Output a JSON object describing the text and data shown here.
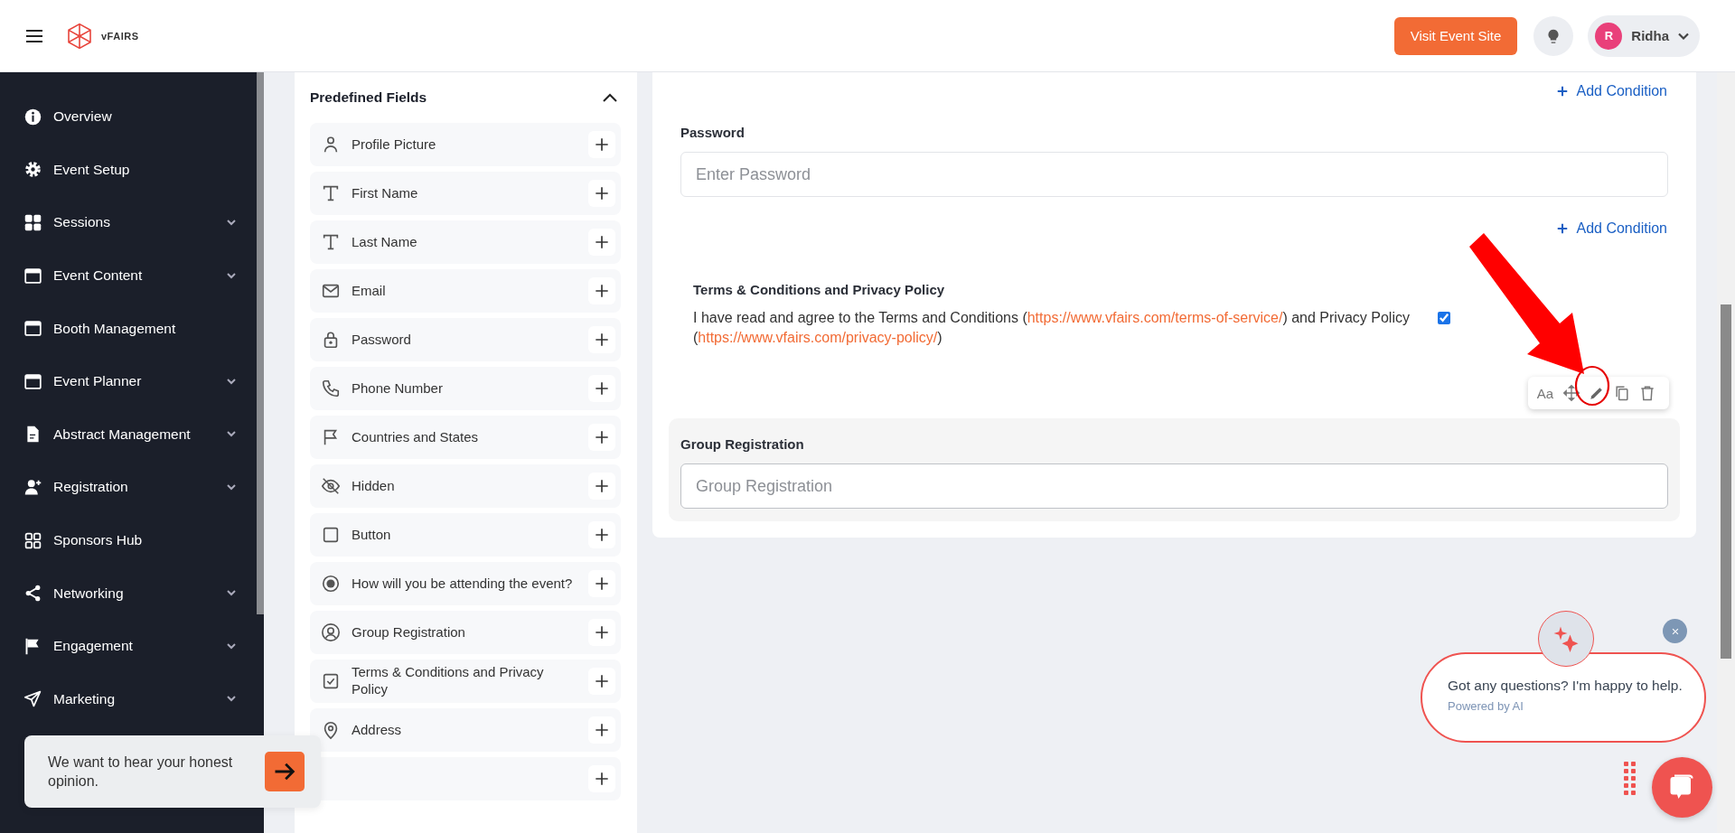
{
  "header": {
    "logo_text": "vFAIRS",
    "visit_button": "Visit Event Site",
    "user": {
      "initial": "R",
      "name": "Ridha"
    }
  },
  "sidebar": {
    "items": [
      {
        "label": "Overview",
        "has_submenu": false
      },
      {
        "label": "Event Setup",
        "has_submenu": false
      },
      {
        "label": "Sessions",
        "has_submenu": true
      },
      {
        "label": "Event Content",
        "has_submenu": true
      },
      {
        "label": "Booth Management",
        "has_submenu": false
      },
      {
        "label": "Event Planner",
        "has_submenu": true
      },
      {
        "label": "Abstract Management",
        "has_submenu": true
      },
      {
        "label": "Registration",
        "has_submenu": true
      },
      {
        "label": "Sponsors Hub",
        "has_submenu": false
      },
      {
        "label": "Networking",
        "has_submenu": true
      },
      {
        "label": "Engagement",
        "has_submenu": true
      },
      {
        "label": "Marketing",
        "has_submenu": true
      }
    ]
  },
  "predefined_fields": {
    "title": "Predefined Fields",
    "expanded": true,
    "fields": [
      {
        "kind": "profile_picture",
        "label": "Profile Picture"
      },
      {
        "kind": "text",
        "label": "First Name"
      },
      {
        "kind": "text",
        "label": "Last Name"
      },
      {
        "kind": "email",
        "label": "Email"
      },
      {
        "kind": "password",
        "label": "Password"
      },
      {
        "kind": "phone",
        "label": "Phone Number"
      },
      {
        "kind": "country",
        "label": "Countries and States"
      },
      {
        "kind": "hidden",
        "label": "Hidden"
      },
      {
        "kind": "button",
        "label": "Button"
      },
      {
        "kind": "radio",
        "label": "How will you be attending the event?"
      },
      {
        "kind": "group",
        "label": "Group Registration"
      },
      {
        "kind": "terms",
        "label": "Terms & Conditions and Privacy Policy"
      },
      {
        "kind": "address",
        "label": "Address"
      },
      {
        "kind": "covered"
      }
    ]
  },
  "form": {
    "items": [
      {
        "kind": "condition_link",
        "label": "Add Condition"
      },
      {
        "kind": "input",
        "label": "Password",
        "placeholder": "Enter Password",
        "highlighted": false
      },
      {
        "kind": "condition_link",
        "label": "Add Condition"
      },
      {
        "kind": "consent",
        "title": "Terms & Conditions and Privacy Policy",
        "checked": true,
        "toolbar_label": "Aa",
        "parts": [
          {
            "kind": "text",
            "text": "I have read and agree to the Terms and Conditions ("
          },
          {
            "kind": "link",
            "text": "https://www.vfairs.com/terms-of-service/"
          },
          {
            "kind": "text",
            "text": ") and Privacy Policy ("
          },
          {
            "kind": "link",
            "text": "https://www.vfairs.com/privacy-policy/"
          },
          {
            "kind": "text",
            "text": ")"
          }
        ]
      },
      {
        "kind": "input",
        "label": "Group Registration",
        "placeholder": "Group Registration",
        "highlighted": true
      }
    ]
  },
  "chat": {
    "message": "Got any questions? I'm happy to help.",
    "subtext": "Powered by AI"
  },
  "feedback": {
    "message": "We want to hear your honest opinion."
  }
}
